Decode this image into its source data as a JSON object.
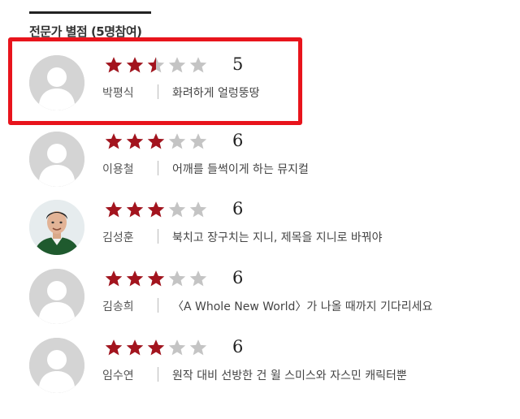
{
  "section": {
    "title": "전문가 별점 (5명참여)"
  },
  "colors": {
    "star_filled": "#a3141e",
    "star_empty": "#c4c4c4",
    "highlight": "#e8141c",
    "avatar_bg": "#d4d4d4"
  },
  "star_max": 5,
  "reviews": [
    {
      "reviewer": "박평식",
      "score": "5",
      "stars_filled": 2.5,
      "comment": "화려하게 얼렁뚱땅",
      "avatar": "placeholder",
      "highlighted": true
    },
    {
      "reviewer": "이용철",
      "score": "6",
      "stars_filled": 3,
      "comment": "어깨를 들썩이게 하는 뮤지컬",
      "avatar": "placeholder",
      "highlighted": false
    },
    {
      "reviewer": "김성훈",
      "score": "6",
      "stars_filled": 3,
      "comment": "북치고 장구치는 지니, 제목을 지니로 바꿔야",
      "avatar": "photo",
      "highlighted": false
    },
    {
      "reviewer": "김송희",
      "score": "6",
      "stars_filled": 3,
      "comment": "〈A Whole New World〉가 나올 때까지 기다리세요",
      "avatar": "placeholder",
      "highlighted": false
    },
    {
      "reviewer": "임수연",
      "score": "6",
      "stars_filled": 3,
      "comment": "원작 대비 선방한 건 윌 스미스와 자스민 캐릭터뿐",
      "avatar": "placeholder",
      "highlighted": false
    }
  ]
}
